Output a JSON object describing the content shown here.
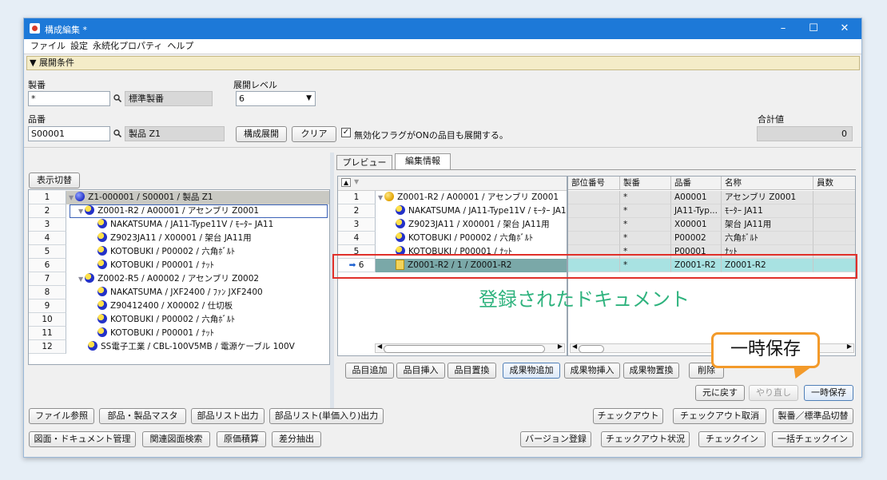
{
  "window": {
    "title": "構成編集 *",
    "controls": [
      "–",
      "☐",
      "✕"
    ]
  },
  "menu": [
    "ファイル",
    "設定",
    "永続化プロパティ",
    "ヘルプ"
  ],
  "conditions": {
    "header": "▼ 展開条件",
    "seiban_label": "製番",
    "seiban_value": "*",
    "seiban_ro": "標準製番",
    "level_label": "展開レベル",
    "level_value": "6",
    "hinban_label": "品番",
    "hinban_value": "S00001",
    "hinban_ro": "製品 Z1",
    "expand_button": "構成展開",
    "clear_button": "クリア",
    "checkbox_label": "無効化フラグがONの品目も展開する。",
    "checkbox_checked": true,
    "total_label": "合計値",
    "total_value": "0"
  },
  "left": {
    "toggle_button": "表示切替",
    "rows": [
      {
        "n": "1",
        "text": "Z1-000001 / S00001 / 製品 Z1"
      },
      {
        "n": "2",
        "text": "Z0001-R2 / A00001 / アセンブリ Z0001"
      },
      {
        "n": "3",
        "text": "NAKATSUMA / JA11-Type11V / ﾓｰﾀｰ JA11"
      },
      {
        "n": "4",
        "text": "Z9023JA11 / X00001 / 架台 JA11用"
      },
      {
        "n": "5",
        "text": "KOTOBUKI / P00002 / 六角ﾎﾞﾙﾄ"
      },
      {
        "n": "6",
        "text": "KOTOBUKI / P00001 / ﾅｯﾄ"
      },
      {
        "n": "7",
        "text": "Z0002-R5 / A00002 / アセンブリ Z0002"
      },
      {
        "n": "8",
        "text": "NAKATSUMA / JXF2400 / ﾌｧﾝ JXF2400"
      },
      {
        "n": "9",
        "text": "Z90412400 / X00002 / 仕切板"
      },
      {
        "n": "10",
        "text": "KOTOBUKI / P00002 / 六角ﾎﾞﾙﾄ"
      },
      {
        "n": "11",
        "text": "KOTOBUKI / P00001 / ﾅｯﾄ"
      },
      {
        "n": "12",
        "text": "SS電子工業 / CBL-100V5MB / 電源ケーブル 100V"
      }
    ]
  },
  "right": {
    "tabs": [
      "プレビュー",
      "編集情報"
    ],
    "rows": [
      {
        "n": "1",
        "text": "Z0001-R2 / A00001 / アセンブリ Z0001"
      },
      {
        "n": "2",
        "text": "NAKATSUMA / JA11-Type11V / ﾓｰﾀｰ JA11"
      },
      {
        "n": "3",
        "text": "Z9023JA11 / X00001 / 架台 JA11用"
      },
      {
        "n": "4",
        "text": "KOTOBUKI / P00002 / 六角ﾎﾞﾙﾄ"
      },
      {
        "n": "5",
        "text": "KOTOBUKI / P00001 / ﾅｯﾄ"
      },
      {
        "n": "6",
        "text": "Z0001-R2 / 1 / Z0001-R2"
      }
    ],
    "columns": [
      "部位番号",
      "製番",
      "品番",
      "名称",
      "員数"
    ],
    "table": [
      [
        "",
        "*",
        "A00001",
        "アセンブリ Z0001",
        ""
      ],
      [
        "",
        "*",
        "JA11-Typ...",
        "ﾓｰﾀｰ JA11",
        ""
      ],
      [
        "",
        "*",
        "X00001",
        "架台 JA11用",
        ""
      ],
      [
        "",
        "*",
        "P00002",
        "六角ﾎﾞﾙﾄ",
        ""
      ],
      [
        "",
        "*",
        "P00001",
        "ﾅｯﾄ",
        ""
      ],
      [
        "",
        "*",
        "Z0001-R2",
        "Z0001-R2",
        ""
      ]
    ],
    "action_buttons": [
      "品目追加",
      "品目挿入",
      "品目置換",
      "成果物追加",
      "成果物挿入",
      "成果物置換",
      "削除"
    ],
    "undo_buttons": [
      "元に戻す",
      "やり直し",
      "一時保存"
    ]
  },
  "bottom": {
    "row1": [
      "ファイル参照",
      "部品・製品マスタ",
      "部品リスト出力",
      "部品リスト(単価入り)出力"
    ],
    "row1r": [
      "チェックアウト",
      "チェックアウト取消",
      "製番／標準品切替"
    ],
    "row2": [
      "図面・ドキュメント管理",
      "関連図面検索",
      "原価積算",
      "差分抽出"
    ],
    "row2r": [
      "バージョン登録",
      "チェックアウト状況",
      "チェックイン",
      "一括チェックイン"
    ]
  },
  "annotations": {
    "registered_doc": "登録されたドキュメント",
    "callout": "一時保存"
  }
}
